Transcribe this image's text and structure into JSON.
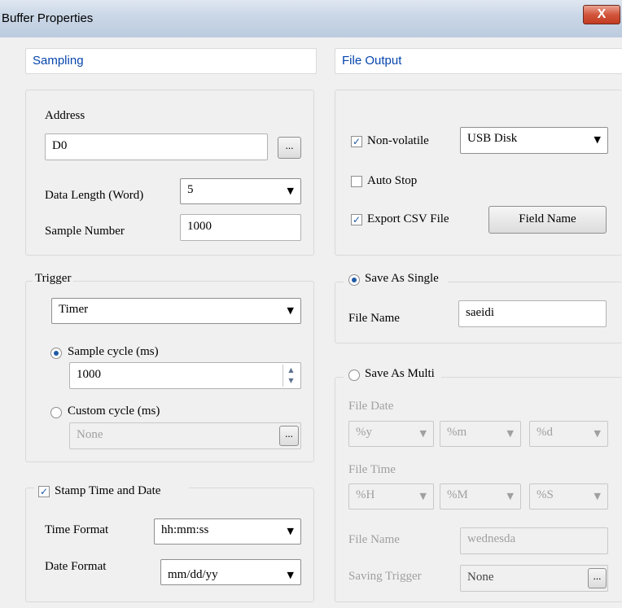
{
  "window": {
    "title": "Buffer Properties",
    "close_label": "X"
  },
  "sampling": {
    "header": "Sampling",
    "address_label": "Address",
    "address_value": "D0",
    "browse_label": "...",
    "data_length_label": "Data Length (Word)",
    "data_length_value": "5",
    "sample_number_label": "Sample Number",
    "sample_number_value": "1000"
  },
  "trigger": {
    "group_label": "Trigger",
    "mode_value": "Timer",
    "sample_cycle_label": "Sample cycle (ms)",
    "sample_cycle_value": "1000",
    "custom_cycle_label": "Custom cycle (ms)",
    "custom_cycle_value": "None",
    "browse_label": "..."
  },
  "stamp": {
    "label": "Stamp Time and Date",
    "time_format_label": "Time Format",
    "time_format_value": "hh:mm:ss",
    "date_format_label": "Date Format",
    "date_format_value": "mm/dd/yy"
  },
  "file_output": {
    "header": "File Output",
    "non_volatile_label": "Non-volatile",
    "storage_value": "USB Disk",
    "auto_stop_label": "Auto Stop",
    "export_csv_label": "Export CSV File",
    "field_name_button": "Field Name"
  },
  "save_single": {
    "label": "Save As Single",
    "file_name_label": "File Name",
    "file_name_value": "saeidi"
  },
  "save_multi": {
    "label": "Save As Multi",
    "file_date_label": "File Date",
    "date_y": "%y",
    "date_m": "%m",
    "date_d": "%d",
    "file_time_label": "File Time",
    "time_h": "%H",
    "time_m": "%M",
    "time_s": "%S",
    "file_name_label": "File Name",
    "file_name_value": "wednesda",
    "saving_trigger_label": "Saving Trigger",
    "saving_trigger_value": "None",
    "browse_label": "..."
  }
}
